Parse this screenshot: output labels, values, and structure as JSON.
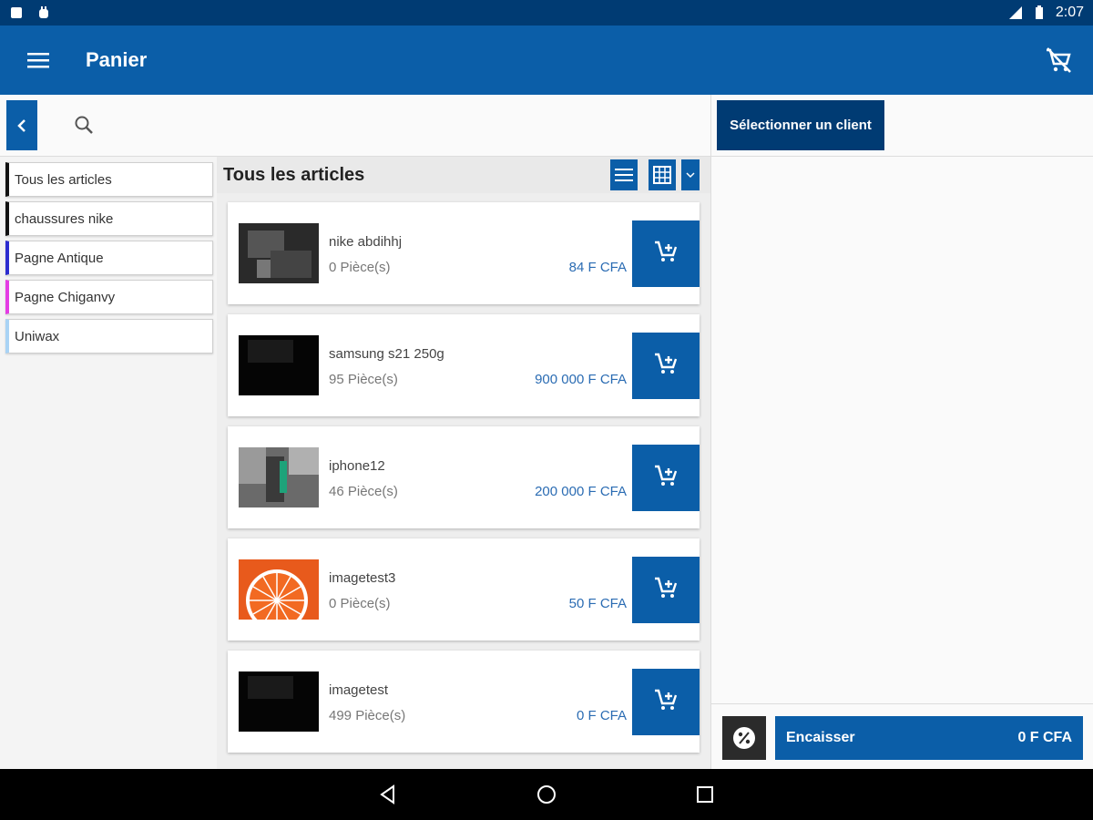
{
  "status_bar": {
    "time": "2:07"
  },
  "app_bar": {
    "title": "Panier"
  },
  "categories": [
    {
      "label": "Tous les articles",
      "color": "#111111"
    },
    {
      "label": "chaussures nike",
      "color": "#111111"
    },
    {
      "label": "Pagne Antique",
      "color": "#2c2ccf"
    },
    {
      "label": "Pagne Chiganvy",
      "color": "#e43de4"
    },
    {
      "label": "Uniwax",
      "color": "#a9d3f5"
    }
  ],
  "products_panel": {
    "title": "Tous les articles"
  },
  "products": [
    {
      "name": "nike abdihhj",
      "quantity": "0 Pièce(s)",
      "price": "84 F CFA",
      "thumb": "dark-gray"
    },
    {
      "name": "samsung s21 250g",
      "quantity": "95 Pièce(s)",
      "price": "900 000 F CFA",
      "thumb": "black"
    },
    {
      "name": "iphone12",
      "quantity": "46 Pièce(s)",
      "price": "200 000 F CFA",
      "thumb": "gray-green"
    },
    {
      "name": "imagetest3",
      "quantity": "0 Pièce(s)",
      "price": "50 F CFA",
      "thumb": "orange-slice"
    },
    {
      "name": "imagetest",
      "quantity": "499 Pièce(s)",
      "price": "0 F CFA",
      "thumb": "black"
    }
  ],
  "client": {
    "button_label": "Sélectionner un client"
  },
  "checkout": {
    "pay_label": "Encaisser",
    "total": "0 F CFA"
  },
  "colors": {
    "primary": "#0b5ea8",
    "dark": "#003b73",
    "price": "#2b6cb3"
  }
}
